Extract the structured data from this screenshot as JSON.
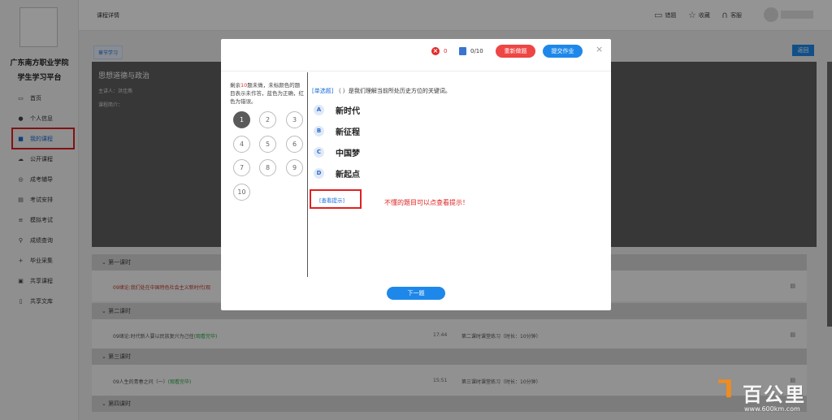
{
  "sidebar": {
    "school_line1": "广东南方职业学院",
    "school_line2": "学生学习平台",
    "items": [
      {
        "label": "首页",
        "icon": "monitor-icon"
      },
      {
        "label": "个人信息",
        "icon": "user-icon"
      },
      {
        "label": "我的课程",
        "icon": "book-icon",
        "active": true
      },
      {
        "label": "公开课程",
        "icon": "cloud-icon"
      },
      {
        "label": "成考辅导",
        "icon": "target-icon"
      },
      {
        "label": "考试安排",
        "icon": "calendar-icon"
      },
      {
        "label": "模拟考试",
        "icon": "list-icon"
      },
      {
        "label": "成绩查询",
        "icon": "search-icon"
      },
      {
        "label": "毕业采集",
        "icon": "plus-icon"
      },
      {
        "label": "共享课程",
        "icon": "share-icon"
      },
      {
        "label": "共享文库",
        "icon": "document-icon"
      }
    ]
  },
  "topbar": {
    "title": "课程详情",
    "tools": [
      {
        "label": "错题",
        "icon": "notebook-icon"
      },
      {
        "label": "收藏",
        "icon": "star-icon"
      },
      {
        "label": "客服",
        "icon": "headset-icon"
      }
    ]
  },
  "page": {
    "tab_chip": "章节学习",
    "back_label": "返回",
    "course_title": "思想道德与政治",
    "teacher": "主讲人：洪佳燕",
    "intro": "课程简介："
  },
  "sections": [
    {
      "title": "第一课时",
      "lesson": "09绪论:我们处在中国特色社会主义新时代(观",
      "lesson_suffix": "",
      "time": "",
      "exercise": "",
      "red": true
    },
    {
      "title": "第二课时",
      "lesson": "09绪论:时代新人要以民族复兴为己任",
      "lesson_suffix": "(观看完毕)",
      "time": "17:44",
      "exercise": "第二课时课堂练习（时长：10分钟）",
      "red": false
    },
    {
      "title": "第三课时",
      "lesson": "09人生的青春之问（一）",
      "lesson_suffix": "(观看完毕)",
      "time": "15:51",
      "exercise": "第三课时课堂练习（时长：10分钟）",
      "red": false
    },
    {
      "title": "第四课时",
      "lesson": "",
      "lesson_suffix": "",
      "time": "",
      "exercise": "",
      "red": false
    }
  ],
  "modal": {
    "wrong_count": "0",
    "progress": "0/10",
    "redo_label": "重新做题",
    "submit_label": "提交作业",
    "close_glyph": "×",
    "hint_pre": "剩余",
    "hint_num": "10",
    "hint_post": "题未做，未标颜色的题目表示未作答，蓝色为正确，红色为错误。",
    "question_numbers": [
      "1",
      "2",
      "3",
      "4",
      "5",
      "6",
      "7",
      "8",
      "9",
      "10"
    ],
    "question_type": "[单选题]",
    "question_text": "（ ）是我们理解当前所处历史方位的关键词。",
    "options": [
      {
        "letter": "A",
        "text": "新时代"
      },
      {
        "letter": "B",
        "text": "新征程"
      },
      {
        "letter": "C",
        "text": "中国梦"
      },
      {
        "letter": "D",
        "text": "新起点"
      }
    ],
    "hint_link": "[查看提示]",
    "hint_note": "不懂的题目可以点查看提示！",
    "next_label": "下一题"
  },
  "watermark": {
    "brand": "百公里",
    "url": "www.600km.com"
  },
  "colors": {
    "primary_blue": "#1e88ea",
    "danger_red": "#ee4545",
    "annotation_red": "#e02020"
  }
}
